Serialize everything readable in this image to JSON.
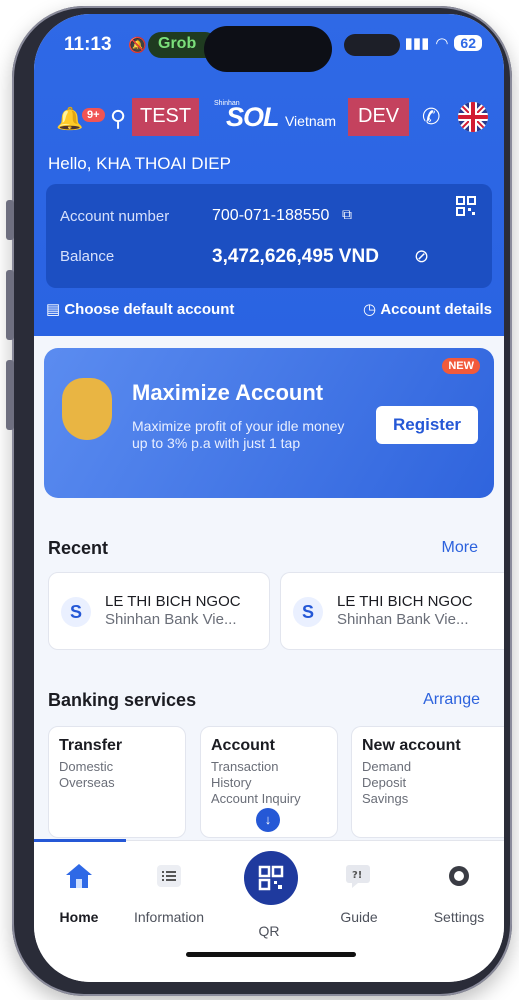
{
  "status_bar": {
    "time": "11:13",
    "grab": "Grob",
    "battery": "62"
  },
  "topbar": {
    "notification_count": "9+",
    "test_label": "TEST",
    "brand_small": "Shinhan",
    "brand_main": "SOL",
    "brand_sub": "Vietnam",
    "dev_label": "DEV"
  },
  "greeting": "Hello, KHA THOAI DIEP",
  "account": {
    "number_label": "Account number",
    "number_value": "700-071-188550",
    "balance_label": "Balance",
    "balance_value": "3,472,626,495",
    "currency": "VND"
  },
  "links": {
    "choose_default": "Choose default account",
    "account_details": "Account details"
  },
  "promo": {
    "badge": "NEW",
    "title": "Maximize Account",
    "description": "Maximize profit of your idle money up to 3% p.a with just 1 tap",
    "button": "Register"
  },
  "recent": {
    "title": "Recent",
    "more": "More",
    "items": [
      {
        "name": "LE THI BICH NGOC",
        "bank": "Shinhan Bank Vie..."
      },
      {
        "name": "LE THI BICH NGOC",
        "bank": "Shinhan Bank Vie..."
      }
    ]
  },
  "services": {
    "title": "Banking services",
    "arrange": "Arrange",
    "cards": [
      {
        "title": "Transfer",
        "items": [
          "Domestic",
          "Overseas"
        ]
      },
      {
        "title": "Account",
        "items": [
          "Transaction",
          "History",
          "Account Inquiry"
        ]
      },
      {
        "title": "New account",
        "items": [
          "Demand",
          "Deposit",
          "Savings"
        ]
      }
    ]
  },
  "nav": {
    "home": "Home",
    "information": "Information",
    "qr": "QR",
    "guide": "Guide",
    "settings": "Settings"
  },
  "colors": {
    "primary": "#2f69e6",
    "card": "#1c4fc2",
    "accent_red": "#c4425e"
  }
}
